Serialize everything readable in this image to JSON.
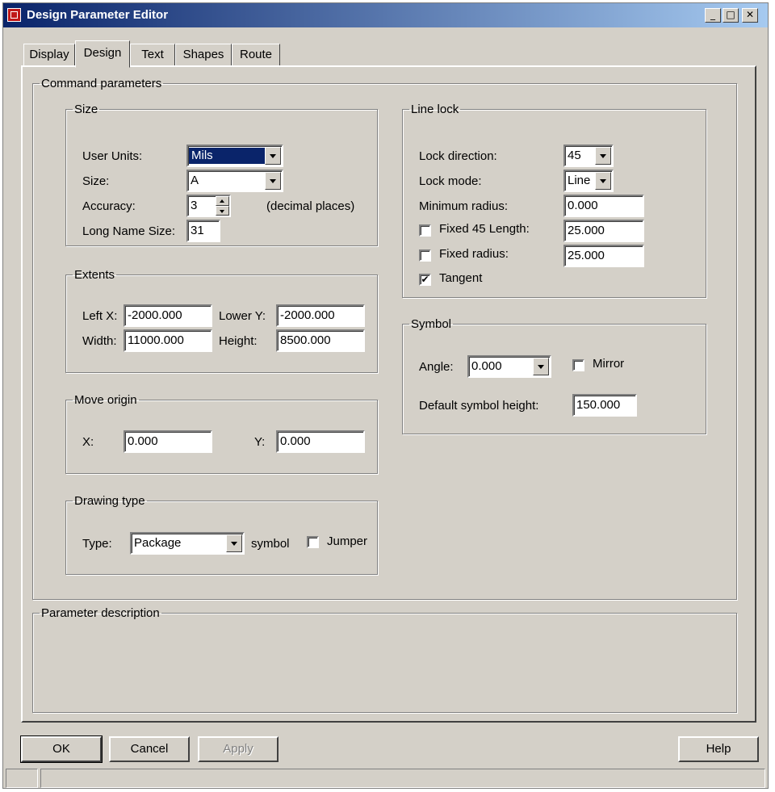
{
  "window": {
    "title": "Design Parameter Editor",
    "min_glyph": "_",
    "max_glyph": "□",
    "close_glyph": "✕"
  },
  "tabs": [
    "Display",
    "Design",
    "Text",
    "Shapes",
    "Route"
  ],
  "active_tab": "Design",
  "command_parameters": {
    "legend": "Command parameters",
    "size": {
      "legend": "Size",
      "user_units_label": "User Units:",
      "user_units_value": "Mils",
      "size_label": "Size:",
      "size_value": "A",
      "accuracy_label": "Accuracy:",
      "accuracy_value": "3",
      "accuracy_units": "(decimal places)",
      "long_name_label": "Long Name Size:",
      "long_name_value": "31"
    },
    "extents": {
      "legend": "Extents",
      "left_x_label": "Left X:",
      "left_x_value": "-2000.000",
      "lower_y_label": "Lower Y:",
      "lower_y_value": "-2000.000",
      "width_label": "Width:",
      "width_value": "11000.000",
      "height_label": "Height:",
      "height_value": "8500.000"
    },
    "move_origin": {
      "legend": "Move origin",
      "x_label": "X:",
      "x_value": "0.000",
      "y_label": "Y:",
      "y_value": "0.000"
    },
    "drawing_type": {
      "legend": "Drawing type",
      "type_label": "Type:",
      "type_value": "Package",
      "symbol_label": "symbol",
      "jumper_label": "Jumper",
      "jumper_checked": false
    },
    "line_lock": {
      "legend": "Line lock",
      "lock_direction_label": "Lock direction:",
      "lock_direction_value": "45",
      "lock_mode_label": "Lock mode:",
      "lock_mode_value": "Line",
      "min_radius_label": "Minimum radius:",
      "min_radius_value": "0.000",
      "fixed45_label": "Fixed 45 Length:",
      "fixed45_checked": false,
      "fixed45_value": "25.000",
      "fixed_radius_label": "Fixed radius:",
      "fixed_radius_checked": false,
      "fixed_radius_value": "25.000",
      "tangent_label": "Tangent",
      "tangent_checked": true,
      "check_glyph": "✔"
    },
    "symbol": {
      "legend": "Symbol",
      "angle_label": "Angle:",
      "angle_value": "0.000",
      "mirror_label": "Mirror",
      "mirror_checked": false,
      "default_height_label": "Default symbol height:",
      "default_height_value": "150.000"
    }
  },
  "parameter_description": {
    "legend": "Parameter description"
  },
  "buttons": {
    "ok": "OK",
    "cancel": "Cancel",
    "apply": "Apply",
    "help": "Help"
  }
}
